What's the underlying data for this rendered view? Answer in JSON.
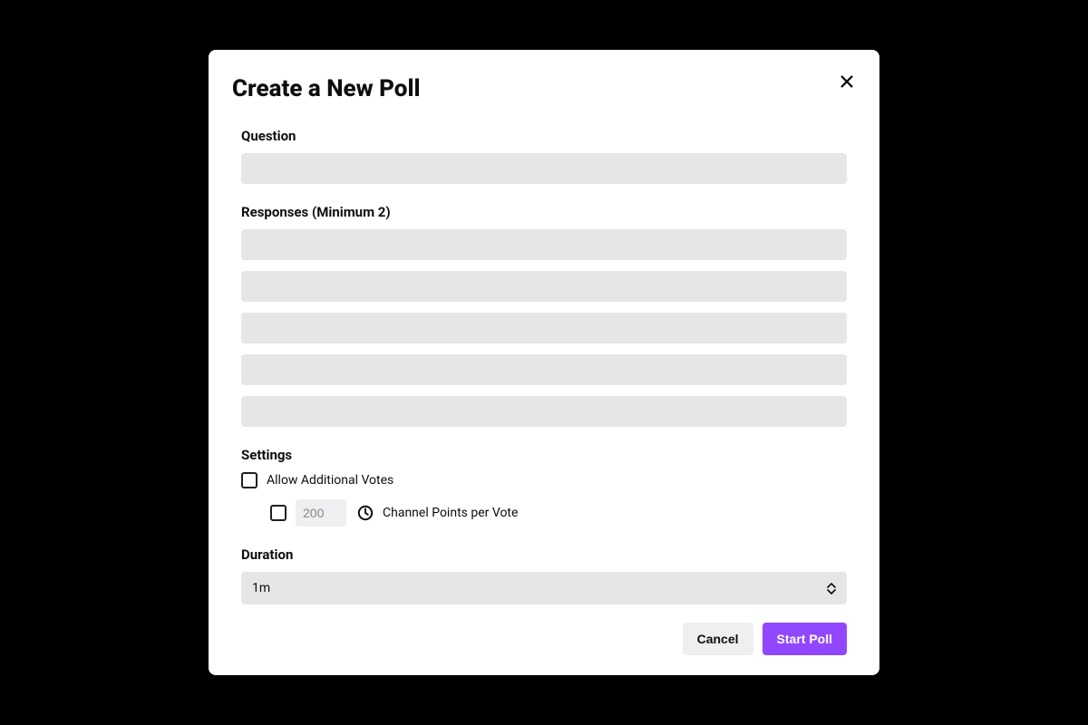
{
  "modal": {
    "title": "Create a New Poll"
  },
  "form": {
    "question_label": "Question",
    "question_value": "",
    "responses_label": "Responses (Minimum 2)",
    "responses": [
      "",
      "",
      "",
      "",
      ""
    ],
    "settings_label": "Settings",
    "allow_additional_votes_label": "Allow Additional Votes",
    "channel_points_placeholder": "200",
    "channel_points_value": "",
    "channel_points_label": "Channel Points per Vote",
    "duration_label": "Duration",
    "duration_value": "1m"
  },
  "buttons": {
    "cancel": "Cancel",
    "start": "Start Poll"
  }
}
